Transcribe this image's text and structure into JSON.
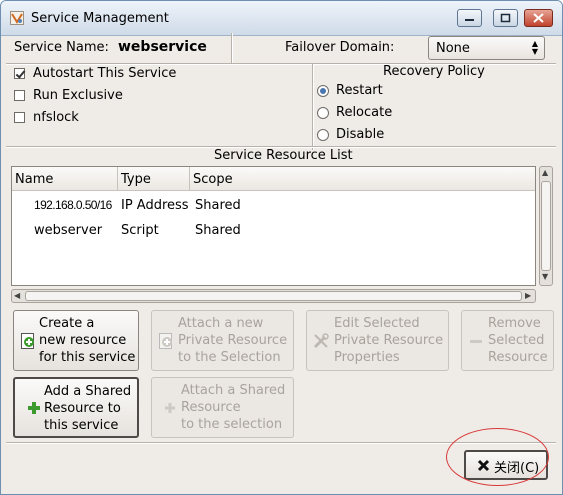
{
  "window": {
    "title": "Service Management"
  },
  "service": {
    "name_label": "Service Name:",
    "name_value": "webservice",
    "failover_label": "Failover Domain:",
    "failover_value": "None"
  },
  "options": {
    "autostart_label": "Autostart This Service",
    "autostart_checked": true,
    "exclusive_label": "Run Exclusive",
    "exclusive_checked": false,
    "nfslock_label": "nfslock",
    "nfslock_checked": false
  },
  "recovery": {
    "title": "Recovery Policy",
    "restart_label": "Restart",
    "relocate_label": "Relocate",
    "disable_label": "Disable",
    "selected": "Restart"
  },
  "resources": {
    "title": "Service Resource List",
    "columns": [
      "Name",
      "Type",
      "Scope"
    ],
    "rows": [
      {
        "name": "192.168.0.50/16",
        "type": "IP Address",
        "scope": "Shared"
      },
      {
        "name": "webserver",
        "type": "Script",
        "scope": "Shared"
      }
    ]
  },
  "buttons": {
    "create_line1": "Create a",
    "create_line2": "new resource",
    "create_line3": "for this service",
    "attach_private_line1": "Attach a new",
    "attach_private_line2": "Private Resource",
    "attach_private_line3": "to the Selection",
    "edit_line1": "Edit Selected",
    "edit_line2": "Private Resource",
    "edit_line3": "Properties",
    "remove_line1": "Remove",
    "remove_line2": "Selected",
    "remove_line3": "Resource",
    "add_shared_line1": "Add a Shared",
    "add_shared_line2": "Resource to",
    "add_shared_line3": "this service",
    "attach_shared_line1": "Attach a Shared",
    "attach_shared_line2": "Resource",
    "attach_shared_line3": "to the selection",
    "close_label": "关闭(C)"
  },
  "icons": {
    "title": "app-icon",
    "create": "plus-page-icon",
    "add_shared": "plus-icon",
    "edit": "tools-icon",
    "remove": "minus-icon",
    "close": "x-icon"
  },
  "colors": {
    "accent": "#4a76b0",
    "annotation": "#d83a3a",
    "icon_green": "#3c9a2e"
  }
}
